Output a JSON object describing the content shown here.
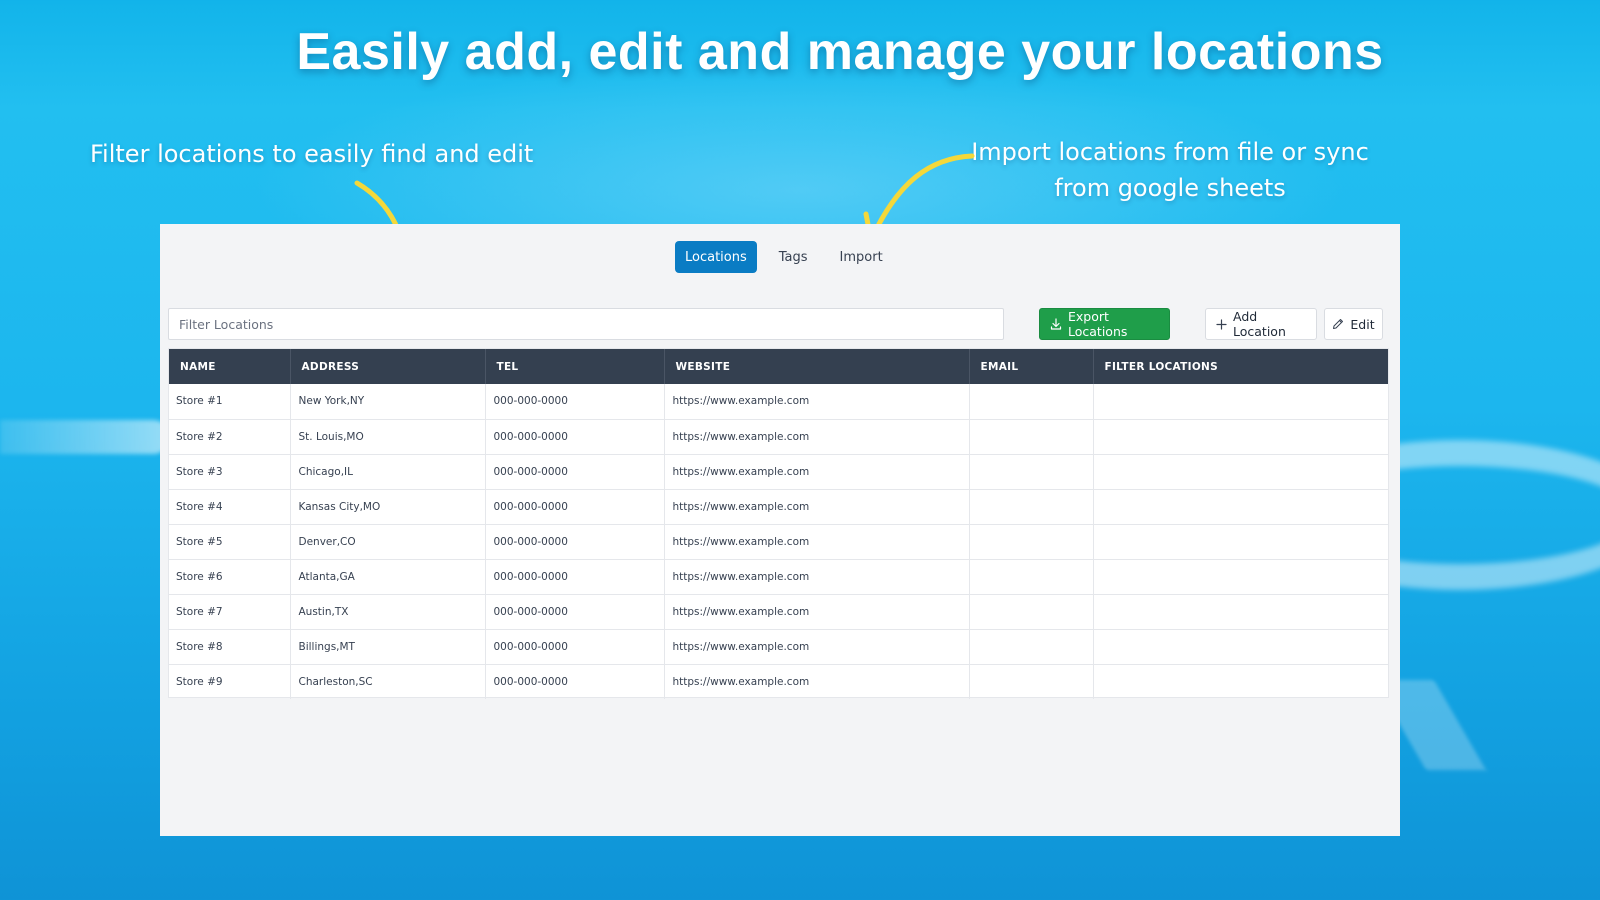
{
  "headline": "Easily add, edit and manage your locations",
  "callouts": {
    "filter": "Filter locations to easily find and edit",
    "import_line1": "Import  locations from file or sync",
    "import_line2": "from google sheets"
  },
  "colors": {
    "accent_tab": "#0a7cc4",
    "export_button": "#1f9e4a",
    "table_header": "#344050",
    "arrow": "#f4d83a"
  },
  "tabs": [
    {
      "label": "Locations",
      "active": true
    },
    {
      "label": "Tags",
      "active": false
    },
    {
      "label": "Import",
      "active": false
    }
  ],
  "toolbar": {
    "filter_placeholder": "Filter Locations",
    "export_label": "Export Locations",
    "export_icon": "download-icon",
    "add_label": "Add Location",
    "add_icon": "plus-icon",
    "edit_label": "Edit",
    "edit_icon": "pencil-icon"
  },
  "table": {
    "columns": [
      "NAME",
      "ADDRESS",
      "TEL",
      "WEBSITE",
      "EMAIL",
      "FILTER LOCATIONS"
    ],
    "rows": [
      [
        "Store #1",
        "New York,NY",
        "000-000-0000",
        "https://www.example.com",
        "",
        ""
      ],
      [
        "Store #2",
        "St. Louis,MO",
        "000-000-0000",
        "https://www.example.com",
        "",
        ""
      ],
      [
        "Store #3",
        "Chicago,IL",
        "000-000-0000",
        "https://www.example.com",
        "",
        ""
      ],
      [
        "Store #4",
        "Kansas City,MO",
        "000-000-0000",
        "https://www.example.com",
        "",
        ""
      ],
      [
        "Store #5",
        "Denver,CO",
        "000-000-0000",
        "https://www.example.com",
        "",
        ""
      ],
      [
        "Store #6",
        "Atlanta,GA",
        "000-000-0000",
        "https://www.example.com",
        "",
        ""
      ],
      [
        "Store #7",
        "Austin,TX",
        "000-000-0000",
        "https://www.example.com",
        "",
        ""
      ],
      [
        "Store #8",
        "Billings,MT",
        "000-000-0000",
        "https://www.example.com",
        "",
        ""
      ],
      [
        "Store #9",
        "Charleston,SC",
        "000-000-0000",
        "https://www.example.com",
        "",
        ""
      ]
    ]
  }
}
